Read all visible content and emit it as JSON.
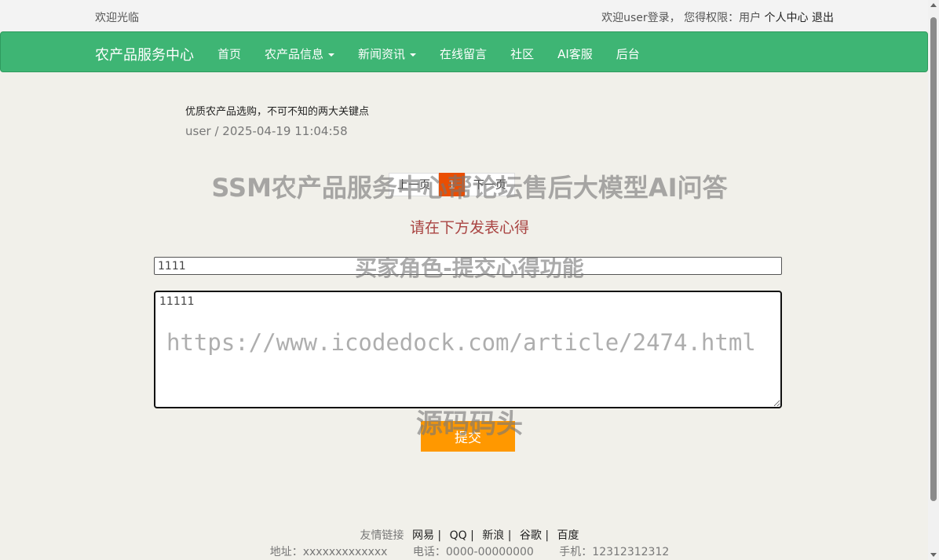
{
  "topbar": {
    "welcome": "欢迎光临",
    "user_text": "欢迎user登录，  您得权限：用户",
    "profile_link": "个人中心",
    "logout_link": "退出"
  },
  "navbar": {
    "brand": "农产品服务中心",
    "items": [
      {
        "label": "首页",
        "dropdown": false
      },
      {
        "label": "农产品信息",
        "dropdown": true
      },
      {
        "label": "新闻资讯",
        "dropdown": true
      },
      {
        "label": "在线留言",
        "dropdown": false
      },
      {
        "label": "社区",
        "dropdown": false
      },
      {
        "label": "AI客服",
        "dropdown": false
      },
      {
        "label": "后台",
        "dropdown": false
      }
    ]
  },
  "article": {
    "title": "优质农产品选购，不可不知的两大关键点",
    "meta": "user / 2025-04-19 11:04:58"
  },
  "pager": {
    "prev": "上一页",
    "current": "1",
    "next": "下一页"
  },
  "form": {
    "prompt": "请在下方发表心得",
    "title_value": "1111",
    "content_value": "11111",
    "submit_label": "提交"
  },
  "watermarks": {
    "line1": "SSM农产品服务中心帮论坛售后大模型AI问答",
    "line2": "买家角色-提交心得功能",
    "line3": "https://www.icodedock.com/article/2474.html",
    "line4": "源码码头"
  },
  "footer": {
    "links_label": "友情链接",
    "links": [
      "网易 |",
      "QQ |",
      "新浪 |",
      "谷歌 |",
      "百度"
    ],
    "address": "地址：xxxxxxxxxxxxx",
    "phone": "电话：0000-00000000",
    "mobile": "手机：12312312312"
  },
  "colors": {
    "navbar": "#3eb574",
    "page_bg": "#f1f0ea",
    "pager_active": "#ea4e02",
    "submit": "#ff9800",
    "prompt": "#a94442"
  }
}
